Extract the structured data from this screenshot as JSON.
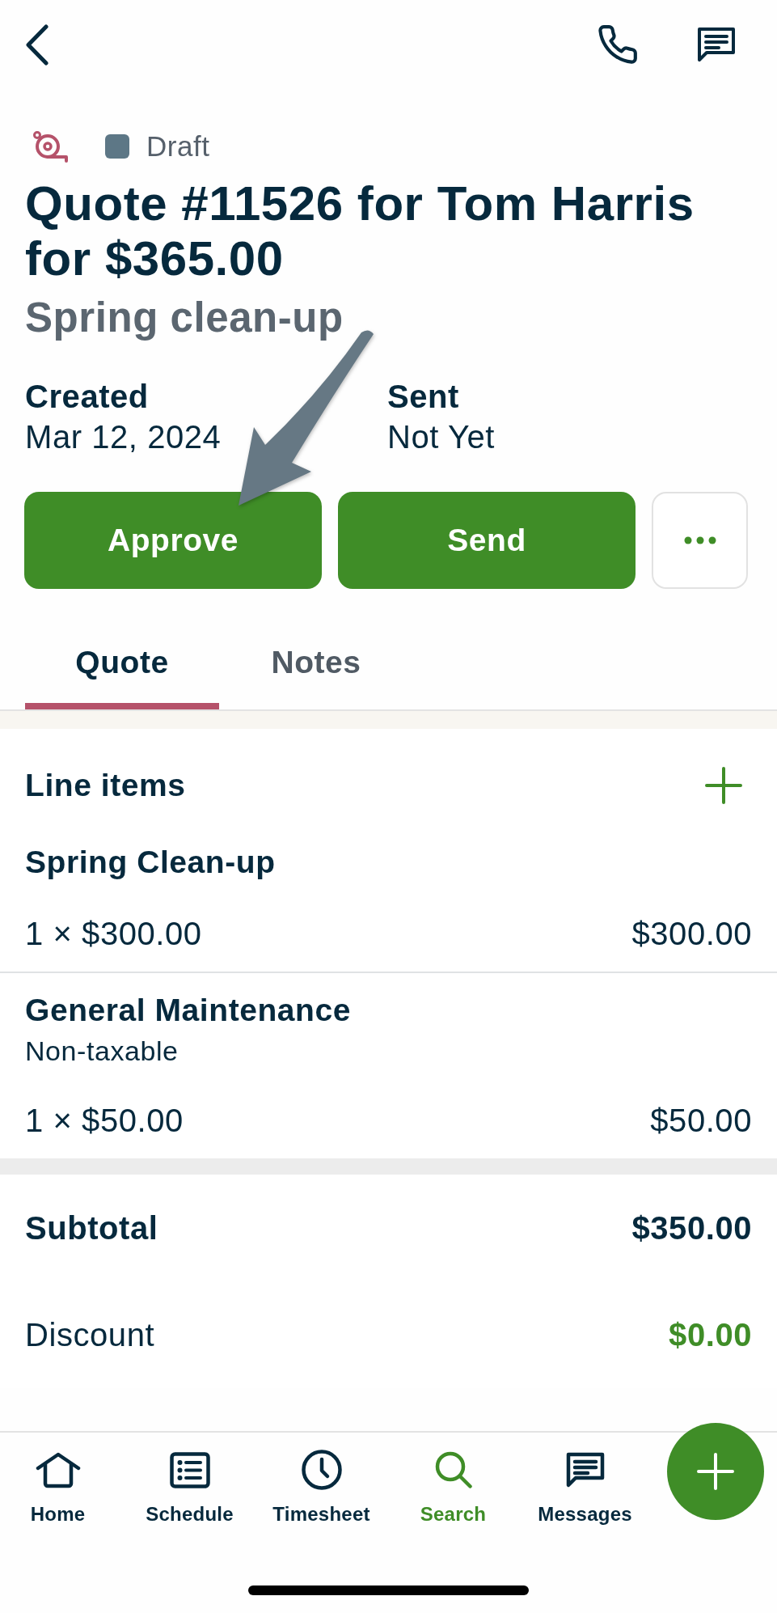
{
  "status": {
    "label": "Draft"
  },
  "title": "Quote #11526 for Tom Harris for $365.00",
  "subtitle": "Spring clean-up",
  "details": [
    {
      "label": "Created",
      "value": "Mar 12, 2024"
    },
    {
      "label": "Sent",
      "value": "Not Yet"
    }
  ],
  "actions": [
    {
      "kind": "primary",
      "label": "Approve"
    },
    {
      "kind": "primary",
      "label": "Send"
    },
    {
      "kind": "more"
    }
  ],
  "tabs": [
    {
      "label": "Quote",
      "selected": true
    },
    {
      "label": "Notes",
      "selected": false
    }
  ],
  "line_items": {
    "title": "Line items",
    "items": [
      {
        "name": "Spring Clean-up",
        "quantity_price": "1 × $300.00",
        "total": "$300.00"
      },
      {
        "name": "General Maintenance",
        "note": "Non-taxable",
        "quantity_price": "1 × $50.00",
        "total": "$50.00"
      }
    ]
  },
  "totals": [
    {
      "kind": "subtotal",
      "label": "Subtotal",
      "value": "$350.00"
    },
    {
      "kind": "discount",
      "label": "Discount",
      "value": "$0.00"
    }
  ],
  "nav": [
    {
      "kind": "home",
      "label": "Home",
      "selected": false
    },
    {
      "kind": "schedule",
      "label": "Schedule",
      "selected": false
    },
    {
      "kind": "timesheet",
      "label": "Timesheet",
      "selected": false
    },
    {
      "kind": "search",
      "label": "Search",
      "selected": true
    },
    {
      "kind": "messages",
      "label": "Messages",
      "selected": false
    }
  ]
}
